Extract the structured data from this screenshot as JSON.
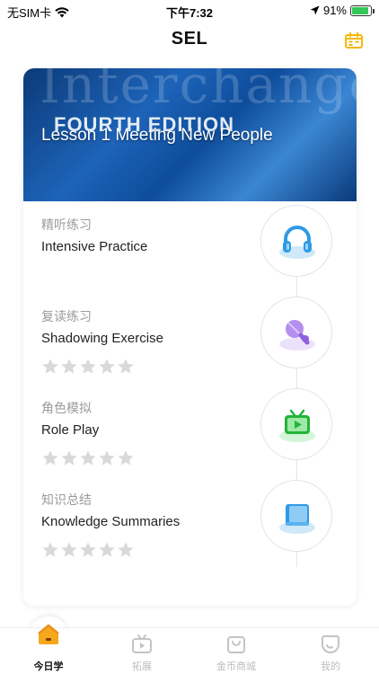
{
  "status_bar": {
    "carrier": "无SIM卡",
    "time": "下午7:32",
    "battery": "91%",
    "battery_level": 0.91,
    "battery_color": "#34c759"
  },
  "header": {
    "title": "SEL",
    "calendar_icon": "calendar-icon",
    "accent_color": "#f5b70a"
  },
  "lesson": {
    "cover_title": "Interchange",
    "cover_edition": "FOURTH EDITION",
    "title": "Lesson 1 Meeting New People"
  },
  "activities": [
    {
      "cn": "精听练习",
      "en": "Intensive Practice",
      "icon": "headphones-icon",
      "stars": null
    },
    {
      "cn": "复读练习",
      "en": "Shadowing Exercise",
      "icon": "microphone-icon",
      "stars": 0
    },
    {
      "cn": "角色模拟",
      "en": "Role Play",
      "icon": "tv-play-icon",
      "stars": 0
    },
    {
      "cn": "知识总结",
      "en": "Knowledge Summaries",
      "icon": "book-icon",
      "stars": 0
    }
  ],
  "tabbar": {
    "items": [
      {
        "label": "今日学",
        "icon": "home-icon",
        "active": true
      },
      {
        "label": "拓展",
        "icon": "video-icon",
        "active": false
      },
      {
        "label": "金币商城",
        "icon": "shopping-bag-icon",
        "active": false
      },
      {
        "label": "我的",
        "icon": "profile-icon",
        "active": false
      }
    ]
  }
}
